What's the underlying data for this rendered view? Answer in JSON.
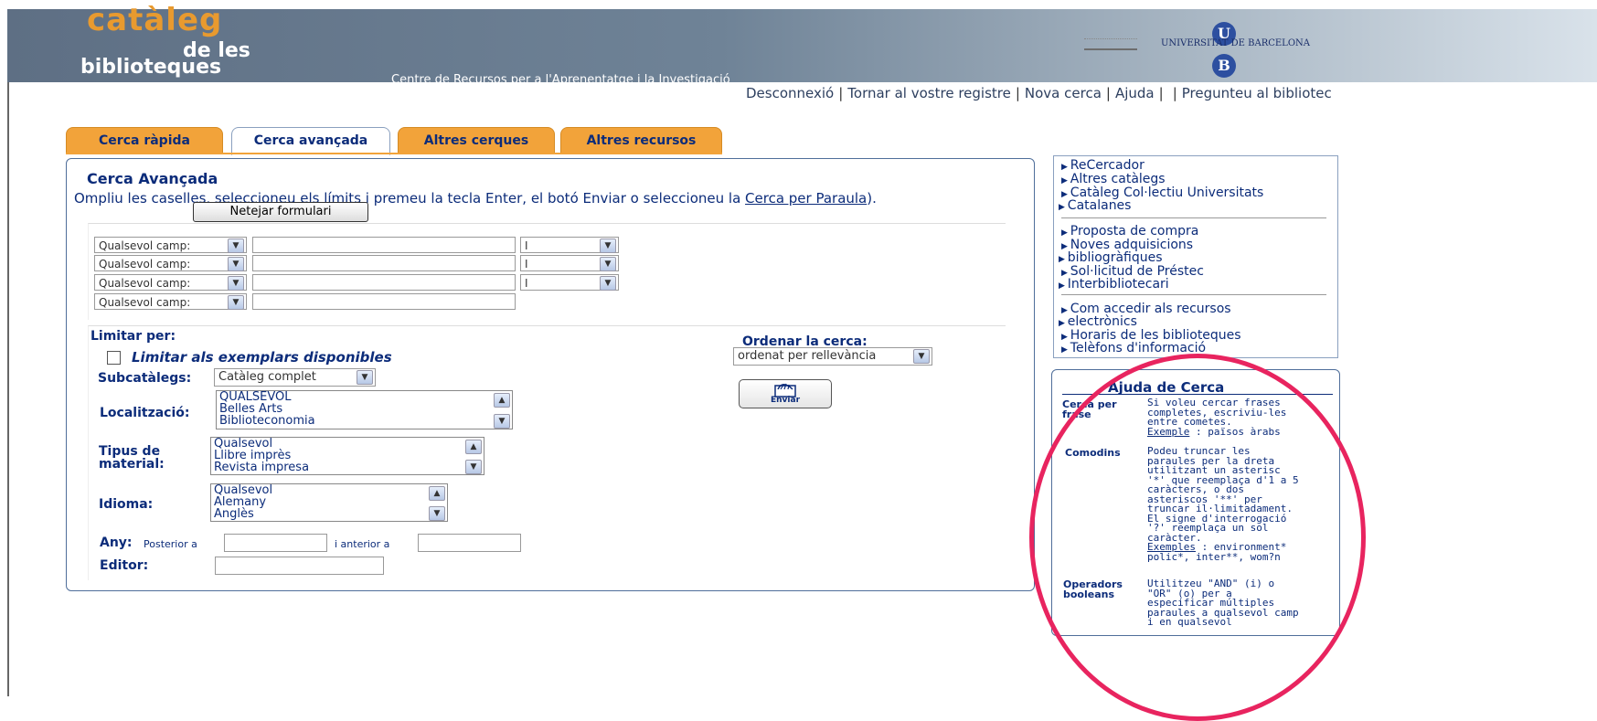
{
  "header": {
    "logo_line1": "catàleg",
    "logo_line2": "de les",
    "logo_line3": "biblioteques",
    "subtitle": "Centre de Recursos per a l'Aprenentatge i la Investigació",
    "university": "UNIVERSITAT DE BARCELONA",
    "ub_u": "U",
    "ub_b": "B"
  },
  "top_links": {
    "disconnect": "Desconnexió",
    "return": "Tornar al vostre registre",
    "new_search": "Nova cerca",
    "help": "Ajuda",
    "ask": "Pregunteu al bibliotec"
  },
  "tabs": [
    "Cerca ràpida",
    "Cerca avançada",
    "Altres cerques",
    "Altres recursos"
  ],
  "form": {
    "title": "Cerca Avançada",
    "description_before": "Ompliu les caselles, seleccioneu els límits i premeu la tecla Enter, el botó Enviar o seleccioneu la ",
    "description_link": "Cerca per Paraula",
    "description_after": ").",
    "clear_button": "Netejar formulari",
    "field_select": "Qualsevol camp:",
    "bool_select": "I",
    "limit_by": "Limitar per:",
    "available_checkbox": "Limitar als exemplars disponibles",
    "subcatalogs_label": "Subcatàlegs:",
    "subcatalogs_value": "Catàleg complet",
    "location_label": "Localització:",
    "location_options": [
      "QUALSEVOL",
      "Belles Arts",
      "Biblioteconomia"
    ],
    "material_label_1": "Tipus de",
    "material_label_2": "material:",
    "material_options": [
      "Qualsevol",
      "Llibre imprès",
      "Revista impresa"
    ],
    "language_label": "Idioma:",
    "language_options": [
      "Qualsevol",
      "Alemany",
      "Anglès"
    ],
    "year_label": "Any:",
    "year_after": "Posterior a",
    "year_before": "i anterior a",
    "publisher_label": "Editor:",
    "sort_label": "Ordenar la cerca:",
    "sort_value": "ordenat per rellevància",
    "send_button": "Enviar"
  },
  "sidebar": {
    "links": [
      "ReCercador",
      "Altres catàlegs",
      "Catàleg Col·lectiu Universitats",
      "Catalanes",
      "Proposta de compra",
      "Noves adquisicions",
      "bibliogràfiques",
      "Sol·licitud de Préstec",
      "Interbibliotecari",
      "Com accedir als recursos",
      "electrònics",
      "Horaris de les biblioteques",
      "Telèfons d'informació"
    ]
  },
  "help": {
    "title": "Ajuda de Cerca",
    "phrase_term_1": "Cerca per",
    "phrase_term_2": "frase",
    "phrase_desc": "Si voleu cercar frases completes, escriviu-les entre cometes.",
    "phrase_example_label": "Exemple",
    "phrase_example": " : països àrabs",
    "wildcards_term": "Comodins",
    "wildcards_desc": "Podeu truncar les paraules per la dreta utilitzant un asterisc '*' que reemplaça d'1 a 5 caràcters, o dos asteriscos '**' per truncar il·limitadament. El signe d'interrogació '?' reemplaça un sol caràcter.",
    "wildcards_example_label": "Exemples",
    "wildcards_example": " : environment* polic*, inter**, wom?n",
    "boolean_term_1": "Operadors",
    "boolean_term_2": "booleans",
    "boolean_desc": "Utilitzeu \"AND\" (i) o \"OR\" (o) per a especificar múltiples paraules a qualsevol camp i en qualsevol"
  },
  "colors": {
    "tab_orange": "#f2a33a",
    "text_navy": "#0c2c7a",
    "highlight_circle": "#e8245f"
  }
}
